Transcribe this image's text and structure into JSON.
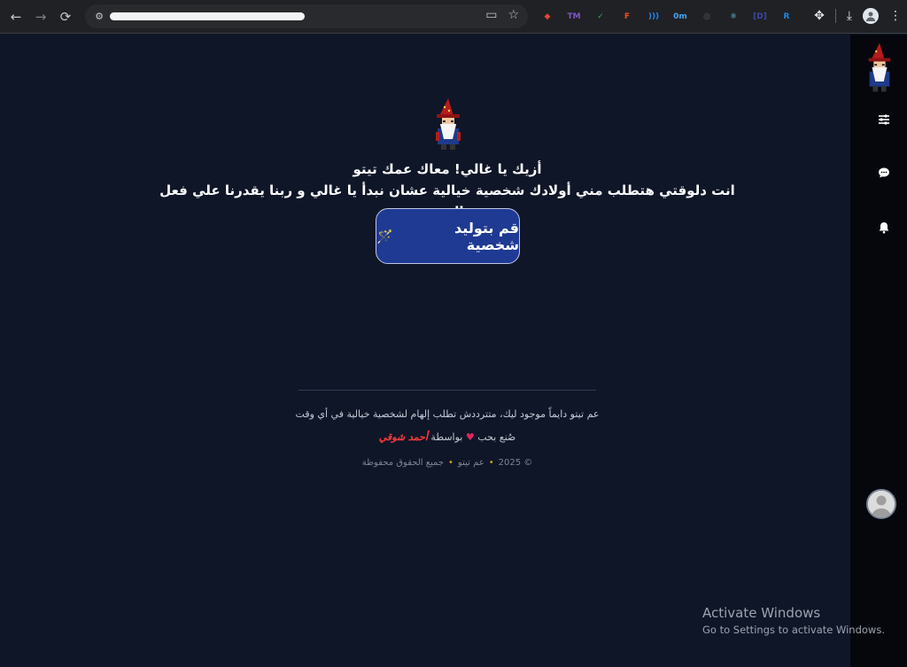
{
  "browser": {
    "nav": {
      "back_icon": "←",
      "forward_icon": "→",
      "reload_icon": "⟳"
    },
    "omnibox_icons": [
      "cast-icon",
      "bookmark-star-icon"
    ],
    "extensions": [
      {
        "name": "google-color-icon",
        "color": "#ea4335",
        "glyph": "◆"
      },
      {
        "name": "tm-icon",
        "color": "#7e57c2",
        "glyph": "TM"
      },
      {
        "name": "check-icon",
        "color": "#34a853",
        "glyph": "✓"
      },
      {
        "name": "figma-icon",
        "color": "#f24e1e",
        "glyph": "F"
      },
      {
        "name": "wave-icon",
        "color": "#1e88e5",
        "glyph": ")))"
      },
      {
        "name": "timer-icon",
        "color": "#42a5f5",
        "glyph": "0m"
      },
      {
        "name": "camera-icon",
        "color": "#5f6368",
        "glyph": "◎"
      },
      {
        "name": "react-icon",
        "color": "#61dafb",
        "glyph": "⚛"
      },
      {
        "name": "dev-icon",
        "color": "#3949ab",
        "glyph": "[D]"
      },
      {
        "name": "brand-icon",
        "color": "#1e88e5",
        "glyph": "R"
      }
    ],
    "right_icons": [
      "puzzle-icon",
      "download-icon"
    ],
    "menu_icon": "⋮"
  },
  "main": {
    "greeting_line1": "أزيك يا غالي! معاك عمك تيتو",
    "greeting_line2": "انت دلوقتي هتطلب مني أولادك شخصية خيالية عشان نبدأ يا غالي و ربنا يقدرنا علي فعل الخير",
    "generate_button": "قم بتوليد شخصية",
    "generate_icon": "magic-wand-icon"
  },
  "footer": {
    "tagline": "عم تيتو دايماً موجود ليك، متترددش تطلب إلهام لشخصية خيالية في أي وقت",
    "made_with": "صُنع بحب",
    "by_label": "بواسطة",
    "author": "أحمد شوقي",
    "copyright": "© 2025",
    "brand": "عم تيتو",
    "rights": "جميع الحقوق محفوظة"
  },
  "sidebar": {
    "items": [
      "sliders-icon",
      "chat-icon",
      "bell-icon"
    ]
  },
  "watermark": {
    "title": "Activate Windows",
    "subtitle": "Go to Settings to activate Windows."
  },
  "colors": {
    "page_bg": "#0f1628",
    "button_bg": "#1f3a93",
    "heart": "#e0245e",
    "author": "#ff3b3b"
  }
}
